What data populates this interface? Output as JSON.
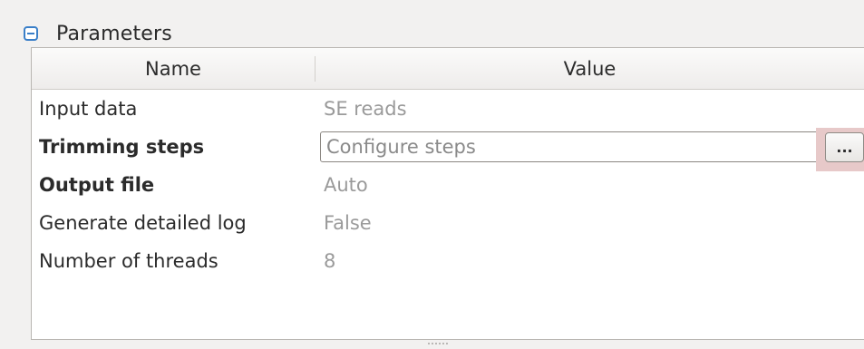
{
  "group": {
    "title": "Parameters",
    "icon": "minus-box-icon",
    "accent_color": "#3a7fc8"
  },
  "table": {
    "headers": {
      "name": "Name",
      "value": "Value"
    },
    "rows": [
      {
        "name": "Input data",
        "value": "SE reads",
        "bold": false
      },
      {
        "name": "Trimming steps",
        "value": "",
        "placeholder": "Configure steps",
        "bold": true
      },
      {
        "name": "Output file",
        "value": "Auto",
        "bold": true
      },
      {
        "name": "Generate detailed log",
        "value": "False",
        "bold": false
      },
      {
        "name": "Number of threads",
        "value": "8",
        "bold": false
      }
    ],
    "browse_button_label": "...",
    "browse_highlight_color": "#e7c9c9"
  }
}
